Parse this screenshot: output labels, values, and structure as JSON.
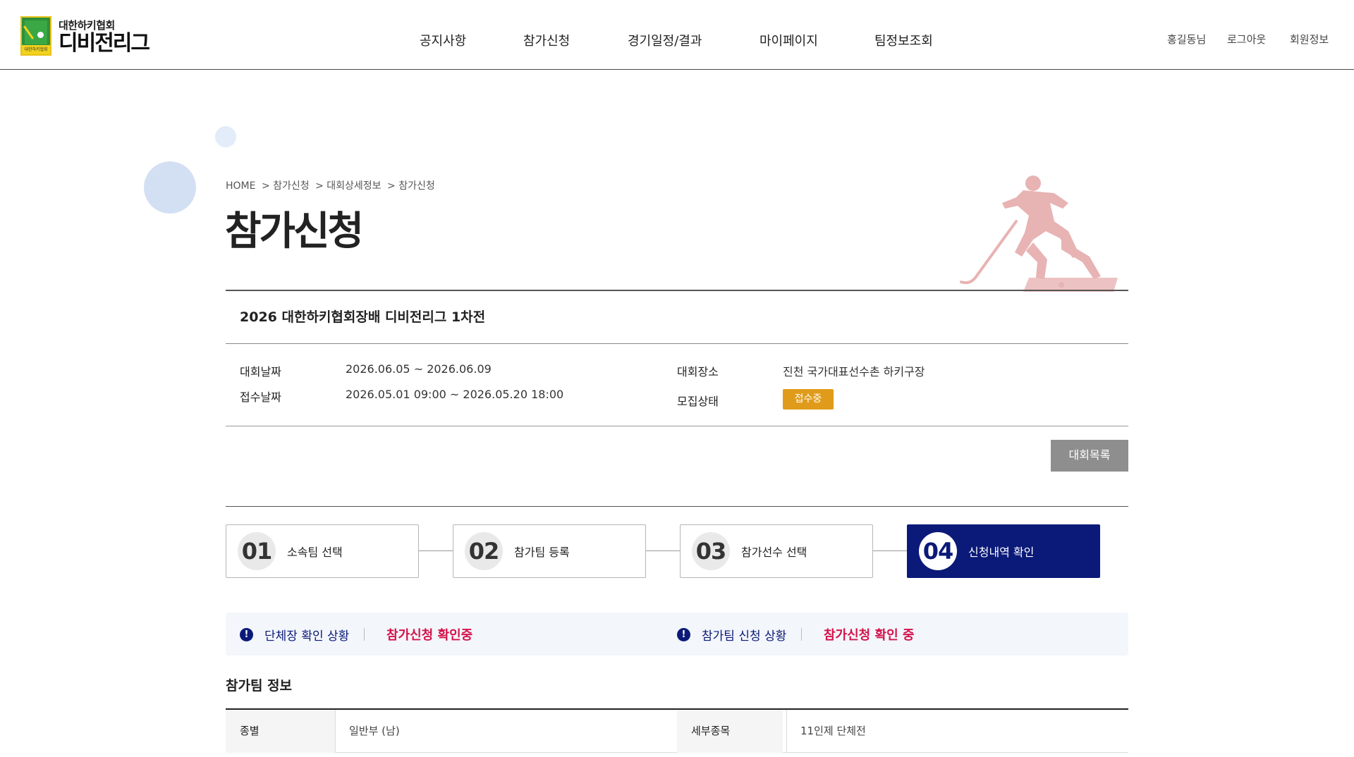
{
  "header": {
    "logo_sub": "대한하키협회",
    "logo_main": "디비전리그",
    "logo_badge": "대한하키협회",
    "nav": [
      "공지사항",
      "참가신청",
      "경기일정/결과",
      "마이페이지",
      "팀정보조회"
    ],
    "user": {
      "name": "홍길동님",
      "logout": "로그아웃",
      "member_info": "회원정보"
    }
  },
  "breadcrumb": [
    "HOME",
    "> 참가신청",
    "> 대회상세정보",
    "> 참가신청"
  ],
  "page_title": "참가신청",
  "competition": {
    "title": "2026 대한하키협회장배 디비전리그 1차전",
    "date_label": "대회날짜",
    "date_value": "2026.06.05 ~ 2026.06.09",
    "reg_label": "접수날짜",
    "reg_value": "2026.05.01 09:00 ~ 2026.05.20 18:00",
    "venue_label": "대회장소",
    "venue_value": "진천 국가대표선수촌 하키구장",
    "status_label": "모집상태",
    "status_badge": "접수중",
    "list_button": "대회목록"
  },
  "steps": [
    {
      "num": "01",
      "label": "소속팀 선택",
      "active": false
    },
    {
      "num": "02",
      "label": "참가팀 등록",
      "active": false
    },
    {
      "num": "03",
      "label": "참가선수 선택",
      "active": false
    },
    {
      "num": "04",
      "label": "신청내역 확인",
      "active": true
    }
  ],
  "status": {
    "icon": "!",
    "org_label": "단체장 확인 상황",
    "org_value": "참가신청 확인중",
    "team_label": "참가팀 신청 상황",
    "team_value": "참가신청 확인 중"
  },
  "team_info": {
    "title": "참가팀 정보",
    "rows": [
      {
        "label1": "종별",
        "value1": "일반부 (남)",
        "label2": "세부종목",
        "value2": "11인제 단체전"
      }
    ]
  },
  "colors": {
    "primary": "#0b1a78",
    "accent_red": "#d4124a",
    "badge_orange": "#e19b1a",
    "button_gray": "#8e8e8e"
  },
  "icons": {
    "alert": "exclamation-circle-icon",
    "hero": "hockey-player-illustration"
  }
}
